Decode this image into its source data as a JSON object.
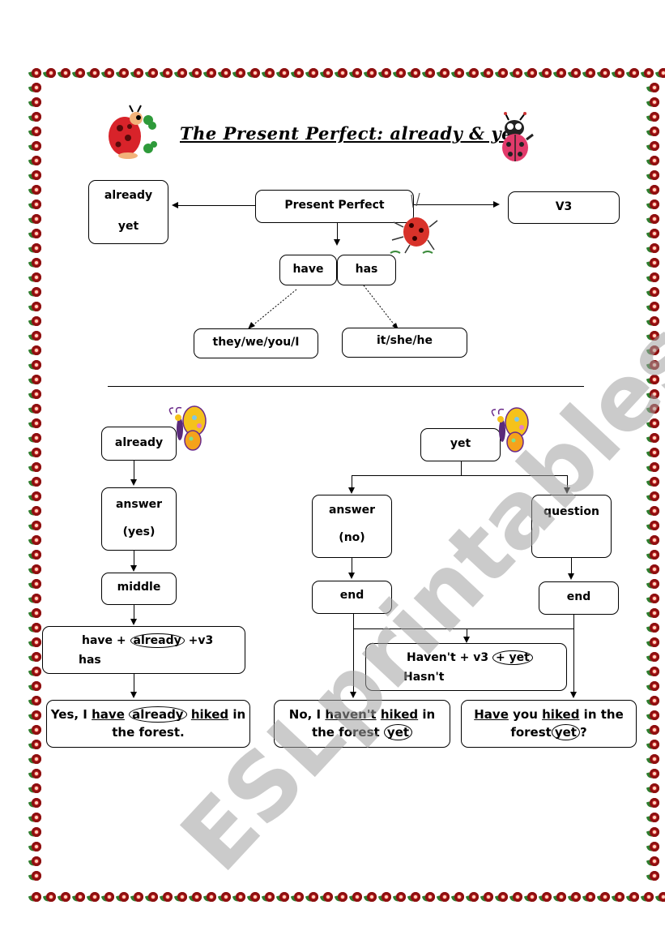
{
  "title": "The Present Perfect: already & yet",
  "top": {
    "center": "Present Perfect",
    "left_box": [
      "already",
      "yet"
    ],
    "right_box": "V3",
    "aux": [
      "have",
      "has"
    ],
    "subjects_have": "they/we/you/I",
    "subjects_has": "it/she/he"
  },
  "already_branch": {
    "head": "already",
    "answer": [
      "answer",
      "(yes)"
    ],
    "position": "middle",
    "formula": {
      "line1_a": "have +",
      "line1_oval": "already",
      "line1_b": "+v3",
      "line2": "has"
    },
    "example": {
      "p1": "Yes, I",
      "w_have": "have",
      "oval": "already",
      "w_hiked": "hiked",
      "p2": "in",
      "p3": "the forest."
    }
  },
  "yet_branch": {
    "head": "yet",
    "answer": [
      "answer",
      "(no)"
    ],
    "question": "question",
    "end_left": "end",
    "end_right": "end",
    "formula": {
      "line1_a": "Haven't + v3",
      "line1_oval": "+ yet",
      "line2": "Hasn't"
    },
    "example_no": {
      "p1": "No, I",
      "w_havent": "haven't",
      "w_hiked": "hiked",
      "p2": "in",
      "p3": "the forest",
      "oval": "yet"
    },
    "example_q": {
      "w_have": "Have",
      "p1": "you",
      "w_hiked": "hiked",
      "p2": "in the",
      "p3": "forest",
      "oval": "yet",
      "p4": "?"
    }
  },
  "watermark": "ESLprintables.com",
  "colors": {
    "border_flower": "#b51a1a",
    "leaf": "#2e7d2e",
    "watermark": "#a0a0a0"
  }
}
